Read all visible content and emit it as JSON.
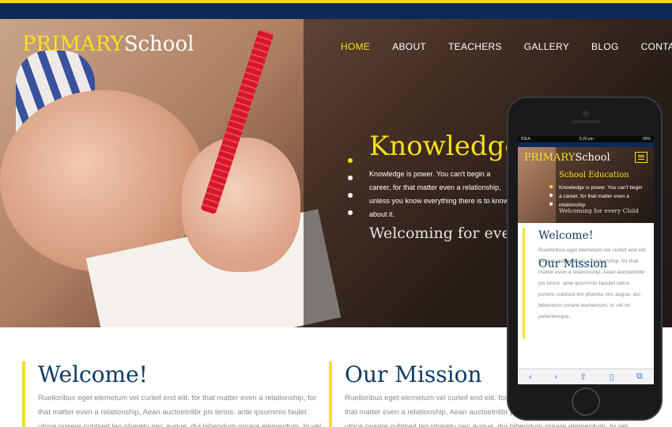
{
  "site": {
    "logo_primary": "PRIMARY",
    "logo_secondary": "School"
  },
  "nav": {
    "items": [
      {
        "label": "HOME",
        "active": true
      },
      {
        "label": "ABOUT",
        "active": false
      },
      {
        "label": "TEACHERS",
        "active": false
      },
      {
        "label": "GALLERY",
        "active": false
      },
      {
        "label": "BLOG",
        "active": false
      },
      {
        "label": "CONTACT",
        "active": false
      }
    ]
  },
  "hero": {
    "title": "Knowledge",
    "text": "Knowledge is power. You can't begin a career, for that matter even a relationship, unless you know everything there is to know about it.",
    "subtitle": "Welcoming for every Child"
  },
  "sections": {
    "welcome": {
      "title": "Welcome!",
      "text": "Ruelloribus eget elemetum vel curleif end elit. for that matter even a relationship, for that matter even a relationship, Aean auctoetnlibr pis terios. ante ipsummis faulet utrice posere cubtsed leo pharetu nec augue. dui bibendum ornare elementum. In vel"
    },
    "mission": {
      "title": "Our Mission",
      "text": "Ruelloribus eget elemetum vel curleif end elit. for that matter even a relationship, for that matter even a relationship, Aean auctoetnlibr pis terios. ante ipsummis faulet utrice posere cubtsed leo pharetu nec augue. dui bibendum ornare elementum. In vel"
    }
  },
  "phone": {
    "status_carrier": "IDEA",
    "status_time": "9:20 pm",
    "status_battery": "90%",
    "hero_title": "School Education",
    "hero_text": "Knowledge is power. You can't begin a career, for that matter even a relationship",
    "hero_sub": "Welcoming for every Child",
    "welcome_title": "Welcome!",
    "welcome_text": "Ruelloribus eget elemetum vel curleif end elit. for that matter even a relationship, for that matter even a relationship, Aean auctoetnlibr pis terios. ante ipsummis fauulet utrice posere cubtsed leo pharetu nec augue. dui bibendum ornare elementum. In vel mi pellentesque.",
    "mission_title": "Our Mission",
    "toolbar": [
      "back-icon",
      "forward-icon",
      "share-icon",
      "bookmarks-icon",
      "tabs-icon"
    ]
  },
  "colors": {
    "accent": "#f6e11b",
    "navy": "#0e3b66",
    "topbar": "#0c2a55"
  }
}
